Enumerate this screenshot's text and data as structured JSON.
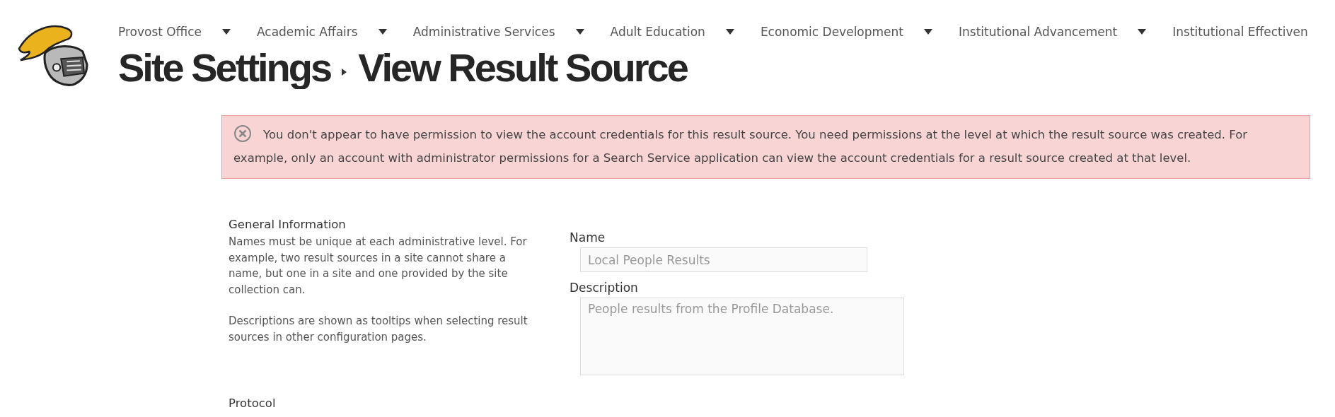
{
  "nav": {
    "items": [
      {
        "label": "Provost Office",
        "has_menu": true
      },
      {
        "label": "Academic Affairs",
        "has_menu": true
      },
      {
        "label": "Administrative Services",
        "has_menu": true
      },
      {
        "label": "Adult Education",
        "has_menu": true
      },
      {
        "label": "Economic Development",
        "has_menu": true
      },
      {
        "label": "Institutional Advancement",
        "has_menu": true
      },
      {
        "label": "Institutional Effectiven",
        "has_menu": false
      }
    ]
  },
  "breadcrumb": [
    "Site Settings",
    "View Result Source"
  ],
  "alert": {
    "kind": "error",
    "message": "You don't appear to have permission to view the account credentials for this result source. You need permissions at the level at which the result source was created. For example, only an account with administrator permissions for a Search Service application can view the account credentials for a result source created at that level."
  },
  "sections": [
    {
      "title": "General Information",
      "paragraphs": [
        "Names must be unique at each administrative level. For example, two result sources in a site cannot share a name, but one in a site and one provided by the site collection can.",
        "Descriptions are shown as tooltips when selecting result sources in other configuration pages."
      ],
      "fields": [
        {
          "kind": "input",
          "label": "Name",
          "value": "Local People Results",
          "disabled": true
        },
        {
          "kind": "textarea",
          "label": "Description",
          "value": "People results from the Profile Database.",
          "disabled": true
        }
      ]
    },
    {
      "title": "Protocol"
    }
  ]
}
